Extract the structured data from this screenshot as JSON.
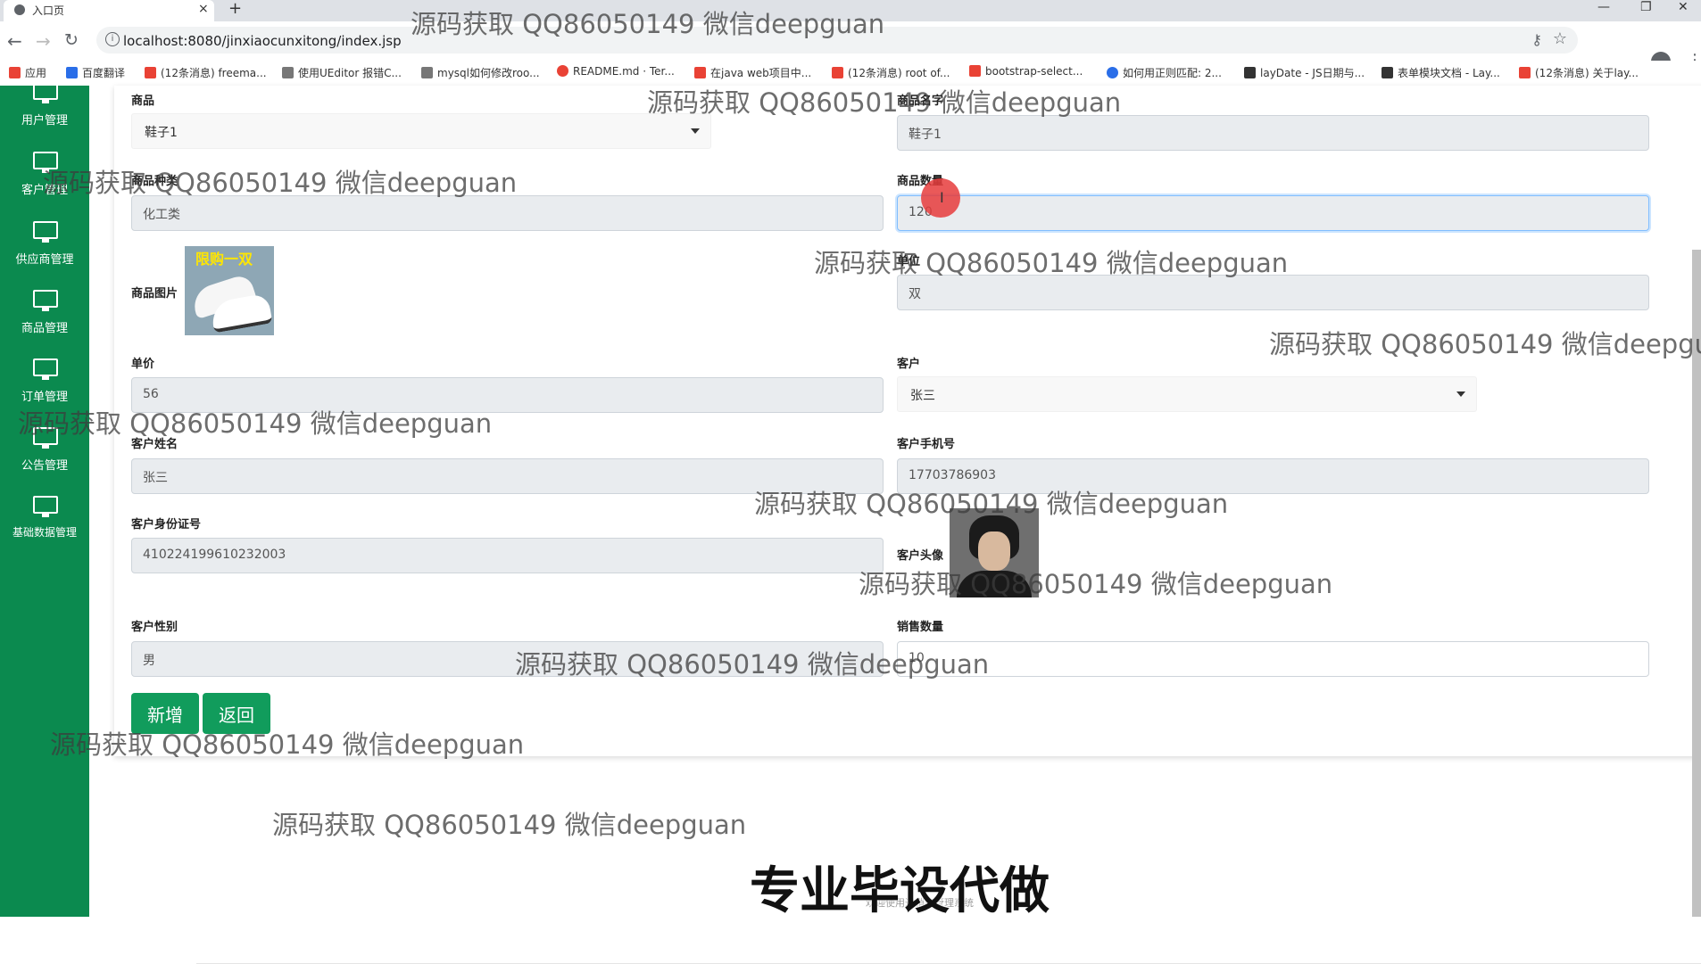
{
  "browser": {
    "tab_title": "入口页",
    "tab_close": "×",
    "new_tab": "+",
    "url": "localhost:8080/jinxiaocunxitong/index.jsp",
    "window_controls": [
      "—",
      "❐",
      "✕"
    ]
  },
  "bookmarks": [
    {
      "label": "应用",
      "color": "#e94235"
    },
    {
      "label": "百度翻译",
      "color": "#2a6ee8"
    },
    {
      "label": "(12条消息) freema...",
      "color": "#e94235"
    },
    {
      "label": "使用UEditor 报错C...",
      "color": "#555555"
    },
    {
      "label": "mysql如何修改roo...",
      "color": "#555555"
    },
    {
      "label": "README.md · Ter...",
      "color": "#e94235"
    },
    {
      "label": "在java web项目中...",
      "color": "#e94235"
    },
    {
      "label": "(12条消息) root of...",
      "color": "#e94235"
    },
    {
      "label": "bootstrap-select...",
      "color": "#e94235"
    },
    {
      "label": "如何用正则匹配: 2...",
      "color": "#2a6ee8"
    },
    {
      "label": "layDate - JS日期与...",
      "color": "#333333"
    },
    {
      "label": "表单模块文档 - Lay...",
      "color": "#333333"
    },
    {
      "label": "(12条消息) 关于lay...",
      "color": "#e94235"
    }
  ],
  "sidebar": [
    {
      "label": "用户管理",
      "icon": "monitor-icon"
    },
    {
      "label": "客户管理",
      "icon": "monitor-icon"
    },
    {
      "label": "供应商管理",
      "icon": "monitor-icon"
    },
    {
      "label": "商品管理",
      "icon": "monitor-icon"
    },
    {
      "label": "订单管理",
      "icon": "monitor-icon"
    },
    {
      "label": "公告管理",
      "icon": "monitor-icon"
    },
    {
      "label": "基础数据管理",
      "icon": "monitor-icon"
    }
  ],
  "form": {
    "product_label": "商品",
    "product_value": "鞋子1",
    "product_name_label": "商品名字",
    "product_name_value": "鞋子1",
    "product_type_label": "商品种类",
    "product_type_value": "化工类",
    "product_qty_label": "商品数量",
    "product_qty_value": "120",
    "product_image_label": "商品图片",
    "product_image_promo": "限购一双",
    "unit_label": "单位",
    "unit_value": "双",
    "price_label": "单价",
    "price_value": "56",
    "customer_label": "客户",
    "customer_value": "张三",
    "customer_name_label": "客户姓名",
    "customer_name_value": "张三",
    "customer_phone_label": "客户手机号",
    "customer_phone_value": "17703786903",
    "customer_id_label": "客户身份证号",
    "customer_id_value": "410224199610232003",
    "customer_avatar_label": "客户头像",
    "customer_gender_label": "客户性别",
    "customer_gender_value": "男",
    "sales_qty_label": "销售数量",
    "sales_qty_value": "10",
    "add_button": "新增",
    "back_button": "返回"
  },
  "overlay": {
    "watermark": "源码获取 QQ86050149 微信deepguan",
    "banner": "专业毕设代做",
    "footer": "欢迎使用进销存管理系统"
  }
}
